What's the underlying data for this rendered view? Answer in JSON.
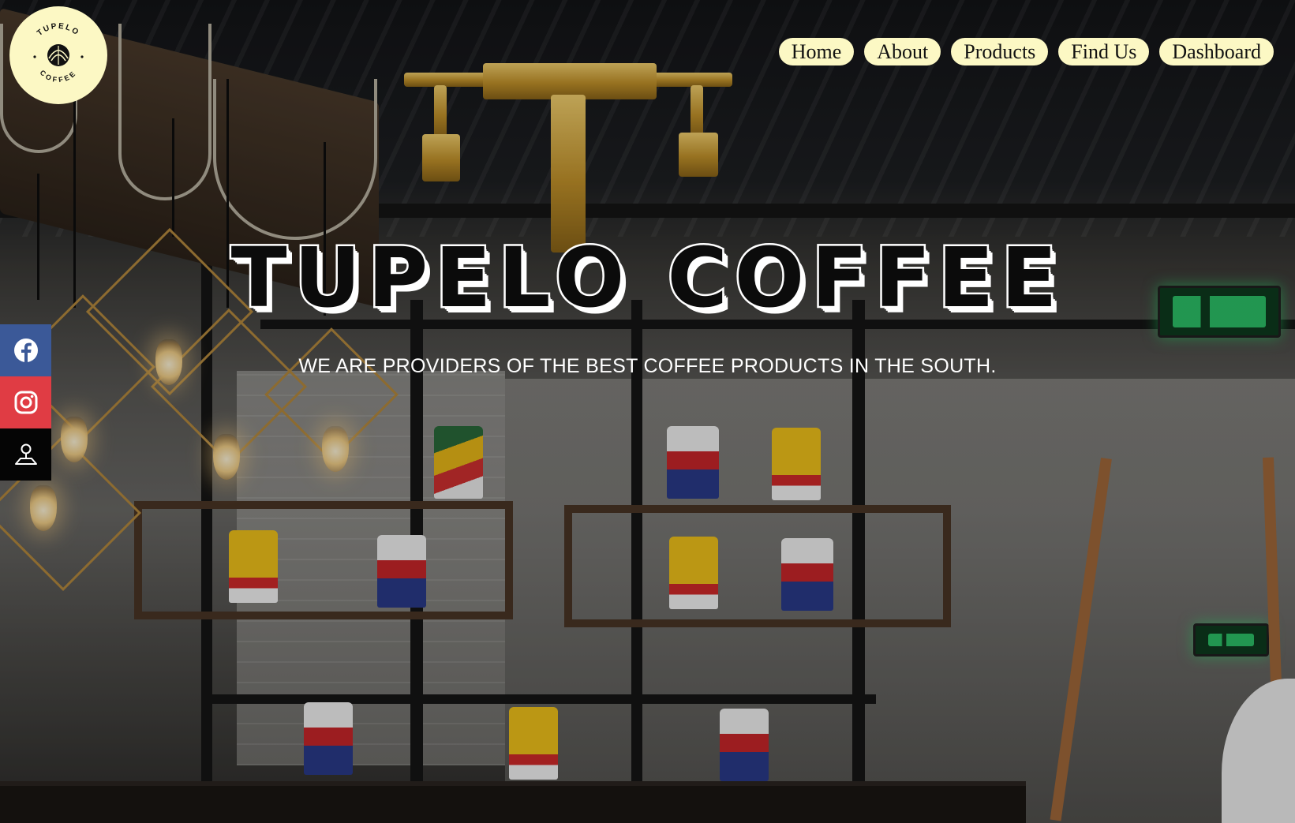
{
  "brand": {
    "logo_lines": [
      "TUPELO",
      "COFFEE"
    ],
    "logo_bg_color": "#fcf8c4"
  },
  "nav": {
    "items": [
      "Home",
      "About",
      "Products",
      "Find Us",
      "Dashboard"
    ],
    "pill_color": "#fcf8c4"
  },
  "hero": {
    "title": "TUPELO COFFEE",
    "subtitle": "WE ARE PROVIDERS OF THE BEST COFFEE PRODUCTS IN THE SOUTH."
  },
  "social": {
    "items": [
      {
        "icon": "facebook-icon",
        "color": "#3b5998"
      },
      {
        "icon": "instagram-icon",
        "color": "#e03c44"
      },
      {
        "icon": "map-pin-icon",
        "color": "#050505"
      }
    ]
  }
}
